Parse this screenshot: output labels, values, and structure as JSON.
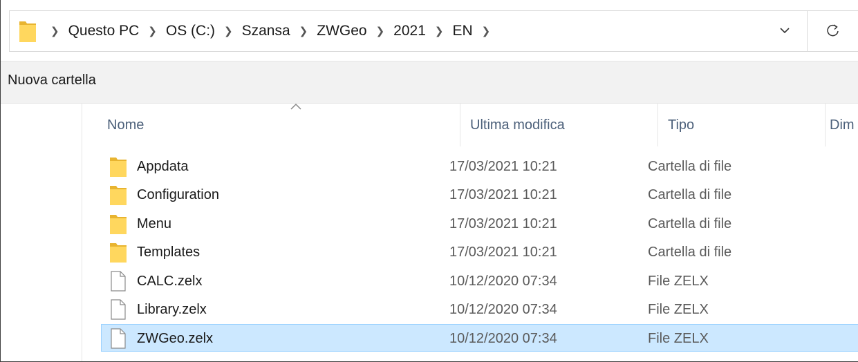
{
  "address_bar": {
    "breadcrumbs": [
      "Questo PC",
      "OS (C:)",
      "Szansa",
      "ZWGeo",
      "2021",
      "EN"
    ],
    "icons": {
      "folder": "folder-icon",
      "dropdown": "chevron-down-icon",
      "refresh": "refresh-icon"
    }
  },
  "command_bar": {
    "new_folder_label": "Nuova cartella"
  },
  "columns": {
    "name": "Nome",
    "modified": "Ultima modifica",
    "type": "Tipo",
    "size": "Dim"
  },
  "files": [
    {
      "icon": "folder-icon",
      "name": "Appdata",
      "modified": "17/03/2021 10:21",
      "type": "Cartella di file"
    },
    {
      "icon": "folder-icon",
      "name": "Configuration",
      "modified": "17/03/2021 10:21",
      "type": "Cartella di file"
    },
    {
      "icon": "folder-icon",
      "name": "Menu",
      "modified": "17/03/2021 10:21",
      "type": "Cartella di file"
    },
    {
      "icon": "folder-icon",
      "name": "Templates",
      "modified": "17/03/2021 10:21",
      "type": "Cartella di file"
    },
    {
      "icon": "file-icon",
      "name": "CALC.zelx",
      "modified": "10/12/2020 07:34",
      "type": "File ZELX"
    },
    {
      "icon": "file-icon",
      "name": "Library.zelx",
      "modified": "10/12/2020 07:34",
      "type": "File ZELX"
    },
    {
      "icon": "file-icon",
      "name": "ZWGeo.zelx",
      "modified": "10/12/2020 07:34",
      "type": "File ZELX",
      "selected": true
    }
  ],
  "colors": {
    "selection_bg": "#cce8ff",
    "selection_border": "#99d1ff",
    "folder_yellow": "#ffd75e",
    "header_text": "#4c607a"
  }
}
